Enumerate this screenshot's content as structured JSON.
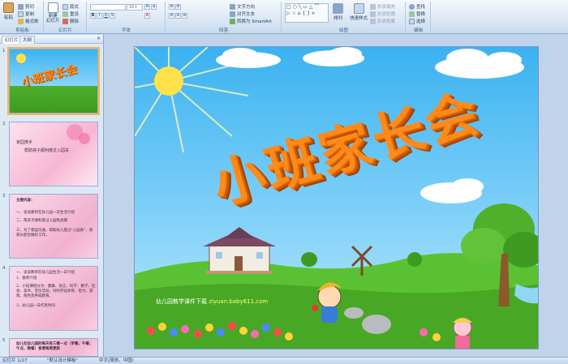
{
  "ribbon": {
    "clipboard": {
      "label": "剪贴板",
      "paste": "粘贴",
      "cut": "剪切",
      "copy": "复制",
      "format_painter": "格式刷"
    },
    "slides": {
      "label": "幻灯片",
      "new_slide": "新建\n幻灯片",
      "layout": "版式",
      "reset": "重设",
      "delete": "删除"
    },
    "font": {
      "label": "字体",
      "font_name": "",
      "font_size": "32+"
    },
    "paragraph": {
      "label": "段落",
      "text_direction": "文字方向",
      "align_text": "对齐文本",
      "smartart": "转换为 SmartArt"
    },
    "drawing": {
      "label": "绘图",
      "arrange": "排列",
      "quick_styles": "快速样式",
      "shape_fill": "形状填充",
      "shape_outline": "形状轮廓",
      "shape_effects": "形状效果"
    },
    "editing": {
      "label": "编辑",
      "find": "查找",
      "replace": "替换",
      "select": "选择"
    }
  },
  "left_panel": {
    "tab_slides": "幻灯片",
    "tab_outline": "大纲",
    "close": "×",
    "thumbnails": [
      {
        "number": "1",
        "text": "小班家长会"
      },
      {
        "number": "2",
        "line1": "家园携手",
        "line2": "帮助孩子顺利度过入园关"
      },
      {
        "number": "3",
        "line1": "主要内容：",
        "line2": "一、谈谈教师在幼儿园一日生活介绍",
        "line3": "二、帮孩子顺利度过入园焦虑期",
        "line4": "三、为了家园沟通，帮助幼儿度过\"入园关\"，请家长配合做好工作。"
      },
      {
        "number": "4",
        "line1": "一、谈谈教师在幼儿园生活一日介绍",
        "line2": "1、教师介绍",
        "line3": "2、小班课程分为：健康、语言、科学、数学、社会、美术、音乐活动，同时开设体育、智力、游戏、角色及养成教育。",
        "line4": "3、幼儿园一日作息时间"
      },
      {
        "number": "5",
        "line1": "幼儿在幼儿园的每天有三餐一点（早餐，午餐，午点，晚餐）食谱每周更新"
      }
    ]
  },
  "slide": {
    "title": "小班家长会",
    "site_label": "幼儿园教学课件下载",
    "site_url": "ziyuan.baby611.com"
  },
  "status_bar": {
    "slide_info": "幻灯片 1/27",
    "theme": "\"默认设计模板\"",
    "language": "中文(简体，中国)"
  },
  "colors": {
    "title": "#ff8a1a",
    "sky": "#3bb2f1",
    "grass": "#4caf2a",
    "accent_selected": "#f7b64a"
  }
}
